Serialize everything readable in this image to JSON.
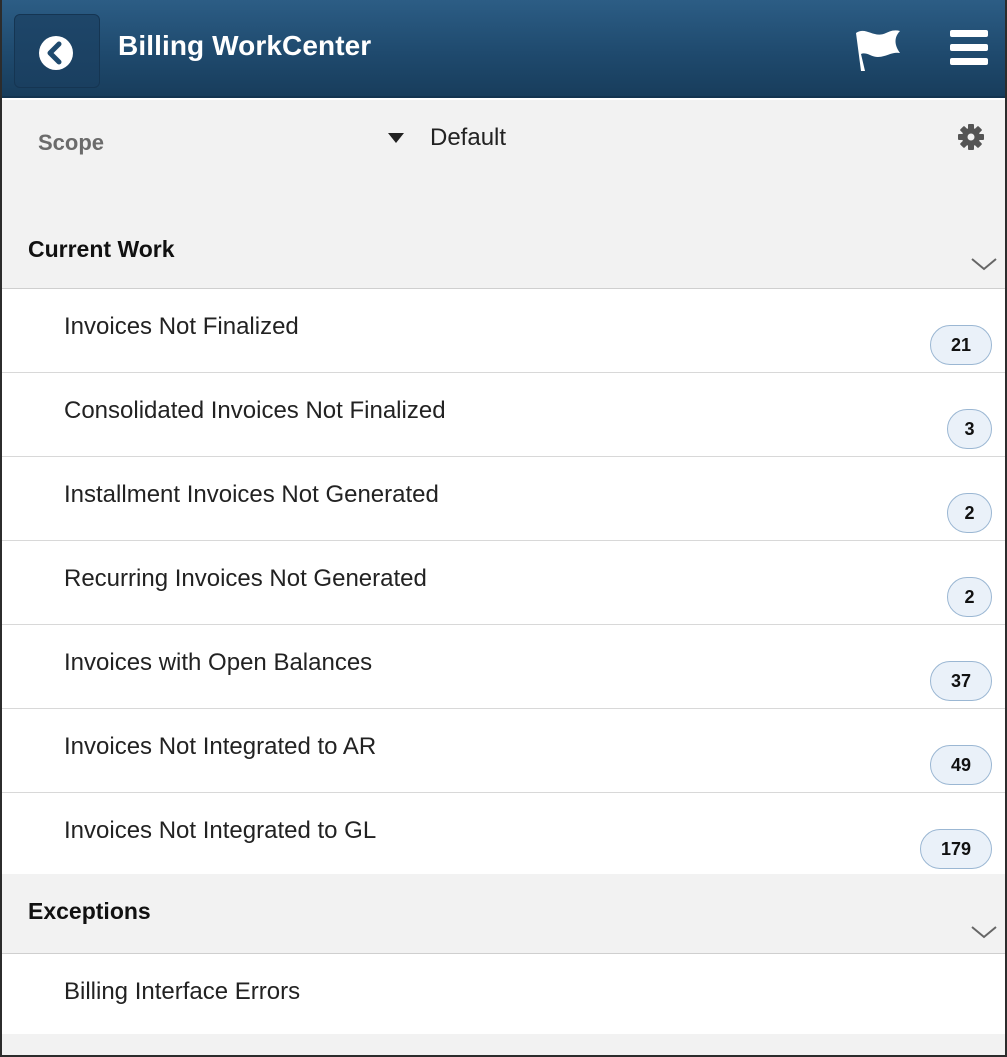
{
  "header": {
    "title": "Billing WorkCenter",
    "back_icon": "chevron-left-icon",
    "flag_icon": "flag-icon",
    "menu_icon": "hamburger-menu-icon"
  },
  "scope": {
    "label": "Scope",
    "selected": "Default",
    "settings_icon": "gear-icon"
  },
  "sections": {
    "current_work": {
      "title": "Current Work",
      "items": [
        {
          "label": "Invoices Not Finalized",
          "count": "21"
        },
        {
          "label": "Consolidated Invoices Not Finalized",
          "count": "3"
        },
        {
          "label": "Installment Invoices Not Generated",
          "count": "2"
        },
        {
          "label": "Recurring Invoices Not Generated",
          "count": "2"
        },
        {
          "label": "Invoices with Open Balances",
          "count": "37"
        },
        {
          "label": "Invoices Not Integrated to AR",
          "count": "49"
        },
        {
          "label": "Invoices Not Integrated to GL",
          "count": "179"
        }
      ]
    },
    "exceptions": {
      "title": "Exceptions",
      "items": [
        {
          "label": "Billing Interface Errors"
        }
      ]
    }
  },
  "colors": {
    "header_bg": "#1f4a6e",
    "badge_bg": "#eaf1f9",
    "badge_border": "#9bb7d3",
    "section_bg": "#f2f2f2"
  }
}
